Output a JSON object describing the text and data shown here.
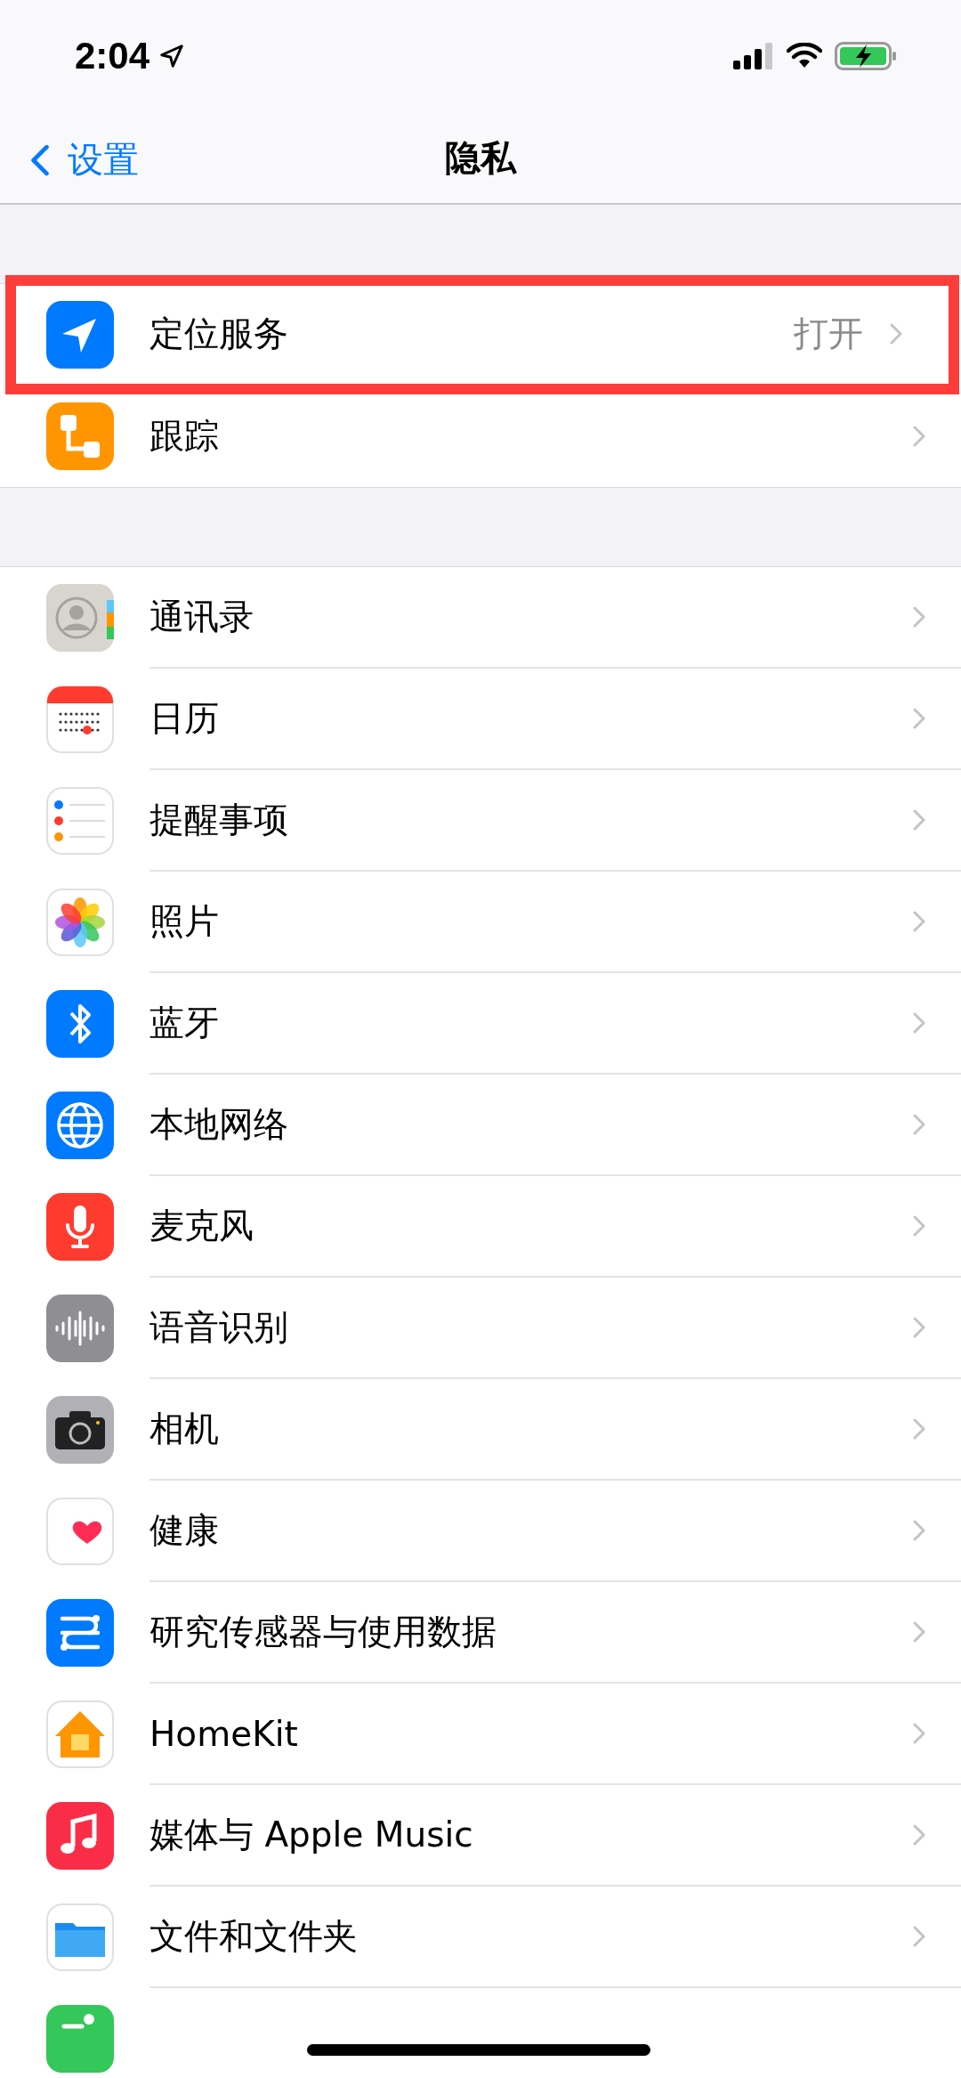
{
  "status_bar": {
    "time": "2:04"
  },
  "nav": {
    "back_label": "设置",
    "title": "隐私"
  },
  "sections": [
    {
      "items": [
        {
          "kind": "location",
          "label": "定位服务",
          "value": "打开",
          "highlighted": true
        },
        {
          "kind": "tracking",
          "label": "跟踪",
          "highlighted": false
        }
      ]
    },
    {
      "items": [
        {
          "kind": "contacts",
          "label": "通讯录",
          "highlighted": false
        },
        {
          "kind": "calendar",
          "label": "日历",
          "highlighted": false
        },
        {
          "kind": "reminders",
          "label": "提醒事项",
          "highlighted": false
        },
        {
          "kind": "photos",
          "label": "照片",
          "highlighted": false
        },
        {
          "kind": "bluetooth",
          "label": "蓝牙",
          "highlighted": false
        },
        {
          "kind": "network",
          "label": "本地网络",
          "highlighted": false
        },
        {
          "kind": "microphone",
          "label": "麦克风",
          "highlighted": false
        },
        {
          "kind": "speech",
          "label": "语音识别",
          "highlighted": false
        },
        {
          "kind": "camera",
          "label": "相机",
          "highlighted": false
        },
        {
          "kind": "health",
          "label": "健康",
          "highlighted": false
        },
        {
          "kind": "research",
          "label": "研究传感器与使用数据",
          "highlighted": false
        },
        {
          "kind": "home",
          "label": "HomeKit",
          "highlighted": false
        },
        {
          "kind": "music",
          "label": "媒体与 Apple Music",
          "highlighted": false
        },
        {
          "kind": "files",
          "label": "文件和文件夹",
          "highlighted": false
        },
        {
          "kind": "fitness",
          "highlighted": false
        }
      ]
    }
  ]
}
